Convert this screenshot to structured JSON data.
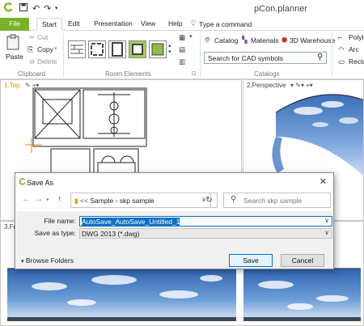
{
  "app": {
    "title": "pCon.planner"
  },
  "tabs": [
    "File",
    "Start",
    "Edit",
    "Presentation",
    "View",
    "Help"
  ],
  "tell_me": "Type a command",
  "ribbon": {
    "clipboard": {
      "paste": "Paste",
      "cut": "Cut",
      "copy": "Copy",
      "delete": "Delete",
      "label": "Clipboard"
    },
    "room_elements_label": "Room Elements",
    "catalogs": {
      "catalog": "Catalog",
      "materials": "Materials",
      "warehouse": "3D Warehouse",
      "search_placeholder": "Search for CAD symbols",
      "label": "Catalogs"
    },
    "draw": {
      "poly": "Polyl",
      "arc": "Arc",
      "rect": "Recta"
    }
  },
  "viewports": {
    "top": "1.Top",
    "perspective": "2.Perspective",
    "front": "3.Fr"
  },
  "dialog": {
    "title": "Save As",
    "breadcrumb": [
      "Sample",
      "skp sample"
    ],
    "search_placeholder": "Search skp sample",
    "file_name_label": "File name:",
    "file_name": "AutoSave_AutoSave_Untitled_1",
    "save_type_label": "Save as type:",
    "save_type": "DWG 2013 (*.dwg)",
    "browse_folders": "Browse Folders",
    "save": "Save",
    "cancel": "Cancel"
  },
  "colors": {
    "accent": "#7bb12a",
    "selection": "#0c71c4"
  }
}
